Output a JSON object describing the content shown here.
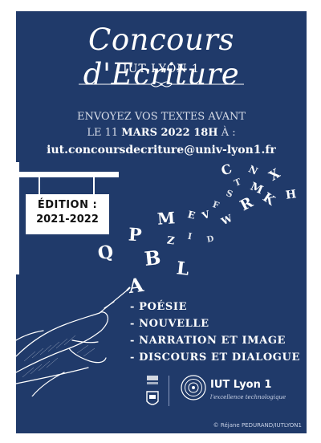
{
  "poster": {
    "title": "Concours d'Ecriture",
    "subtitle": "IUT LYON 1",
    "deadline_line1": "ENVOYEZ VOS TEXTES AVANT",
    "deadline_pre": "LE 11 ",
    "deadline_date": "MARS 2022 18H",
    "deadline_post": " À :",
    "email": "iut.concoursdecriture@univ-lyon1.fr",
    "edition_label": "ÉDITION :",
    "edition_years": "2021-2022",
    "categories": [
      "- POÉSIE",
      "- NOUVELLE",
      "- NARRATION ET IMAGE",
      "- DISCOURS ET DIALOGUE"
    ],
    "flying_letters": [
      "A",
      "L",
      "B",
      "Q",
      "P",
      "Z",
      "M",
      "I",
      "D",
      "E",
      "V",
      "F",
      "W",
      "S",
      "T",
      "R",
      "M",
      "C",
      "N",
      "X",
      "K",
      "H"
    ],
    "iut_logo_name": "IUT Lyon 1",
    "iut_logo_tagline": "l'excellence technologique",
    "credit": "© Réjane PEDURAND/IUTLYON1"
  },
  "colors": {
    "background": "#203a6a",
    "text": "#ffffff"
  }
}
